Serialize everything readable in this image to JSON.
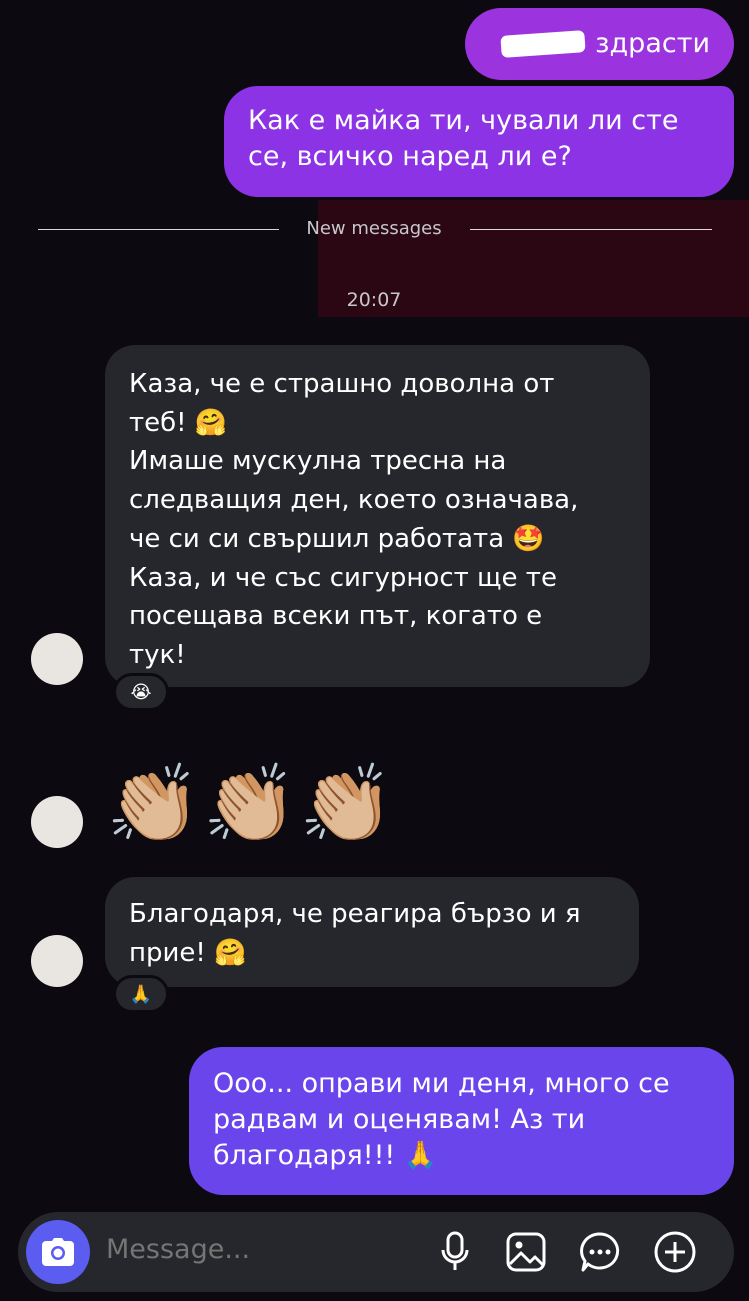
{
  "outgoing": {
    "greeting": "здрасти",
    "question": "Как е майка ти, чували ли сте се, всичко наред ли е?",
    "reply": "Ооо... оправи ми деня, много се радвам и оценявам! Аз ти благодаря!!! 🙏"
  },
  "divider": {
    "label": "New messages",
    "time": "20:07"
  },
  "incoming": {
    "message1_lines": [
      "Каза, че е страшно доволна от",
      "теб! 🤗",
      "Имаше мускулна тресна на",
      "следващия ден, което означава,",
      "че си си свършил работата 🤩",
      "Каза, и че със сигурност ще те",
      "посещава всеки път, когато е",
      "тук!"
    ],
    "reaction1": "😭",
    "clap_emojis": "👏🏼👏🏼👏🏼",
    "message2": "Благодаря, че реагира бързо и я прие! 🤗",
    "reaction2": "🙏"
  },
  "composer": {
    "placeholder": "Message...",
    "icons": [
      "camera-icon",
      "microphone-icon",
      "image-icon",
      "sticker-icon",
      "plus-icon"
    ]
  },
  "colors": {
    "bg": "#0c0a10",
    "out1": "#9b33df",
    "out2": "#8c33e6",
    "out3": "#6a45ec",
    "incoming": "#26262d",
    "camera": "#5b5cf0"
  }
}
